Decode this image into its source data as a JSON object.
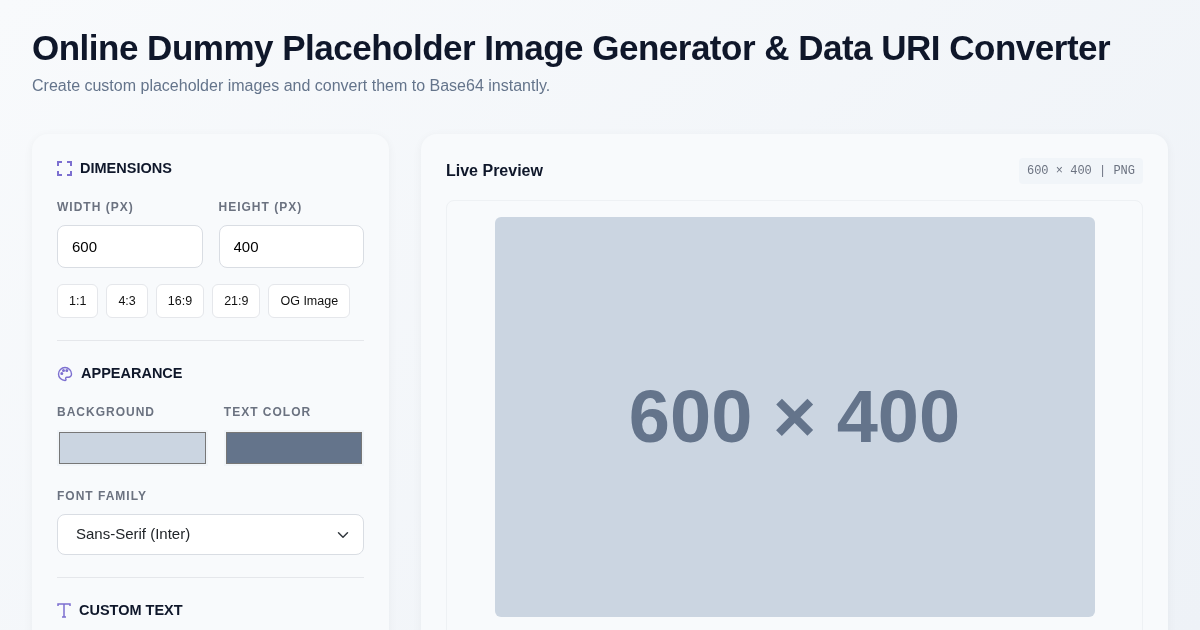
{
  "title": "Online Dummy Placeholder Image Generator & Data URI Converter",
  "subtitle": "Create custom placeholder images and convert them to Base64 instantly.",
  "sections": [
    {
      "kind": "dimensions",
      "heading": "DIMENSIONS",
      "fields": [
        {
          "label": "WIDTH (PX)",
          "value": "600"
        },
        {
          "label": "HEIGHT (PX)",
          "value": "400"
        }
      ],
      "presets": [
        "1:1",
        "4:3",
        "16:9",
        "21:9",
        "OG Image"
      ]
    },
    {
      "kind": "appearance",
      "heading": "APPEARANCE",
      "colors": [
        {
          "label": "BACKGROUND",
          "color": "#cbd5e1"
        },
        {
          "label": "TEXT COLOR",
          "color": "#64748b"
        }
      ],
      "font": {
        "label": "FONT FAMILY",
        "value": "Sans-Serif (Inter)"
      }
    },
    {
      "kind": "text",
      "heading": "CUSTOM TEXT"
    }
  ],
  "preview": {
    "title": "Live Preview",
    "badge": "600 × 400 | PNG",
    "image_text": "600 × 400"
  }
}
